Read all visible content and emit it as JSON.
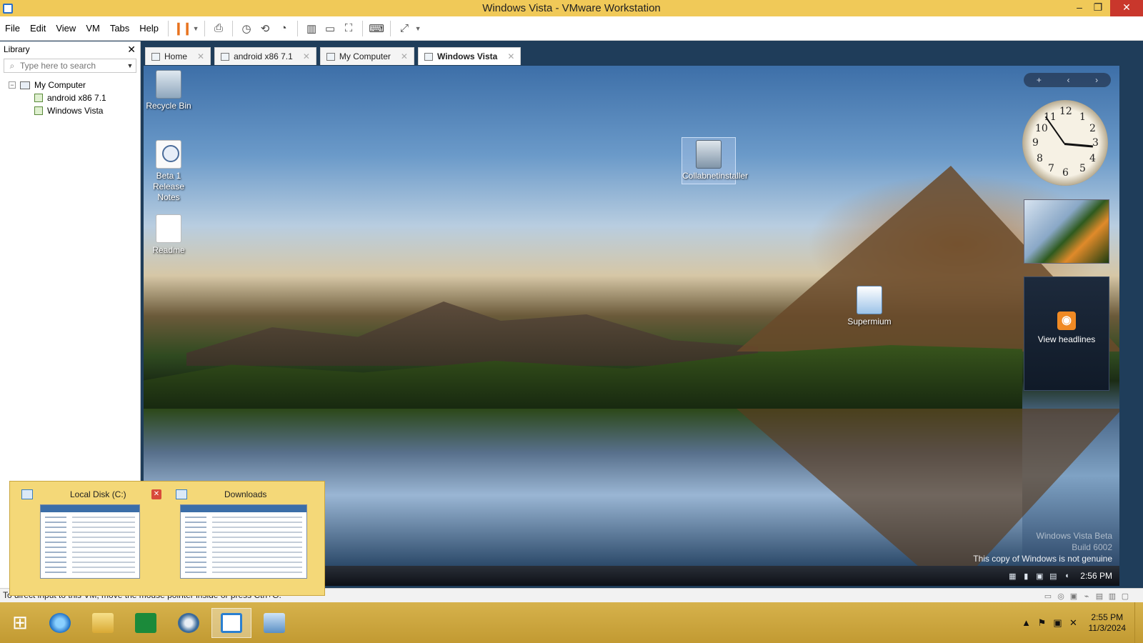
{
  "window": {
    "title": "Windows Vista - VMware Workstation",
    "min_glyph": "–",
    "max_glyph": "❐",
    "close_glyph": "✕"
  },
  "menu": [
    "File",
    "Edit",
    "View",
    "VM",
    "Tabs",
    "Help"
  ],
  "toolbar_icons": [
    "pause-icon",
    "send-ctrl-alt-del-icon",
    "snapshot-icon",
    "revert-snapshot-icon",
    "snapshot-manager-icon",
    "library-view-icon",
    "thumbnail-view-icon",
    "fullscreen-icon",
    "console-view-icon",
    "stretch-icon"
  ],
  "library": {
    "title": "Library",
    "search_placeholder": "Type here to search",
    "tree": {
      "root": "My Computer",
      "children": [
        "android x86 7.1",
        "Windows Vista"
      ]
    }
  },
  "tabs": [
    {
      "label": "Home",
      "active": false
    },
    {
      "label": "android x86 7.1",
      "active": false
    },
    {
      "label": "My Computer",
      "active": false
    },
    {
      "label": "Windows Vista",
      "active": true
    }
  ],
  "desktop_icons": [
    {
      "label": "Recycle Bin"
    },
    {
      "label": "Beta 1 Release Notes"
    },
    {
      "label": "Readme"
    },
    {
      "label": "Collabnetinstaller"
    },
    {
      "label": "Supermium"
    }
  ],
  "gadgets": {
    "toolbar": [
      "+",
      "‹",
      "›"
    ],
    "clock_numbers": [
      "12",
      "1",
      "2",
      "3",
      "4",
      "5",
      "6",
      "7",
      "8",
      "9",
      "10",
      "11"
    ],
    "feeds_label": "View headlines"
  },
  "watermark": {
    "line1": "Windows Vista Beta",
    "line2": "Build 6002",
    "line3": "This copy of Windows is not genuine"
  },
  "guest_taskbar": {
    "time": "2:56 PM"
  },
  "status_bar": {
    "message": "To direct input to this VM, move the mouse pointer inside or press Ctrl+G."
  },
  "thumbnail_popup": [
    {
      "title": "Local Disk (C:)"
    },
    {
      "title": "Downloads"
    }
  ],
  "host_taskbar": {
    "apps": [
      "start-icon",
      "internet-explorer-icon",
      "file-explorer-icon",
      "store-icon",
      "browser-icon",
      "vmware-icon",
      "remote-desktop-icon"
    ],
    "time": "2:55 PM",
    "date": "11/3/2024"
  }
}
